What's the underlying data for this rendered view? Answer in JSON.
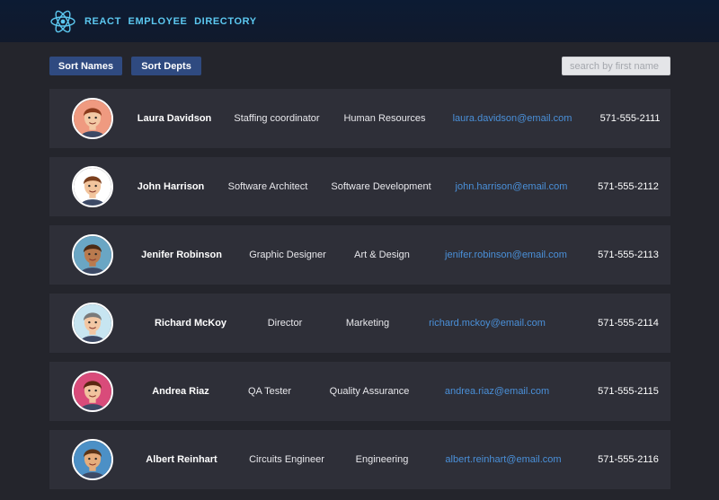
{
  "header": {
    "title": "REACT EMPLOYEE DIRECTORY",
    "logo_icon": "react-atom-icon"
  },
  "toolbar": {
    "sort_names_label": "Sort Names",
    "sort_depts_label": "Sort Depts",
    "search_placeholder": "search by first name",
    "search_value": ""
  },
  "employees": [
    {
      "name": "Laura Davidson",
      "title": "Staffing coordinator",
      "department": "Human Resources",
      "email": "laura.davidson@email.com",
      "phone": "571-555-2111",
      "avatar_bg": "#ef9a80",
      "hair": "#8a3a1c",
      "skin": "#f3c9a5"
    },
    {
      "name": "John Harrison",
      "title": "Software Architect",
      "department": "Software Development",
      "email": "john.harrison@email.com",
      "phone": "571-555-2112",
      "avatar_bg": "#ffffff",
      "hair": "#7b3f1d",
      "skin": "#f2c49c"
    },
    {
      "name": "Jenifer Robinson",
      "title": "Graphic Designer",
      "department": "Art & Design",
      "email": "jenifer.robinson@email.com",
      "phone": "571-555-2113",
      "avatar_bg": "#6aa6c4",
      "hair": "#4b2a14",
      "skin": "#b97a4e"
    },
    {
      "name": "Richard McKoy",
      "title": "Director",
      "department": "Marketing",
      "email": "richard.mckoy@email.com",
      "phone": "571-555-2114",
      "avatar_bg": "#c7e5f1",
      "hair": "#7a7a7a",
      "skin": "#f2c7a4"
    },
    {
      "name": "Andrea Riaz",
      "title": "QA Tester",
      "department": "Quality Assurance",
      "email": "andrea.riaz@email.com",
      "phone": "571-555-2115",
      "avatar_bg": "#d94b7a",
      "hair": "#5a2612",
      "skin": "#f1c29e"
    },
    {
      "name": "Albert Reinhart",
      "title": "Circuits Engineer",
      "department": "Engineering",
      "email": "albert.reinhart@email.com",
      "phone": "571-555-2116",
      "avatar_bg": "#4c90c6",
      "hair": "#5b3417",
      "skin": "#e6ad7c"
    }
  ]
}
